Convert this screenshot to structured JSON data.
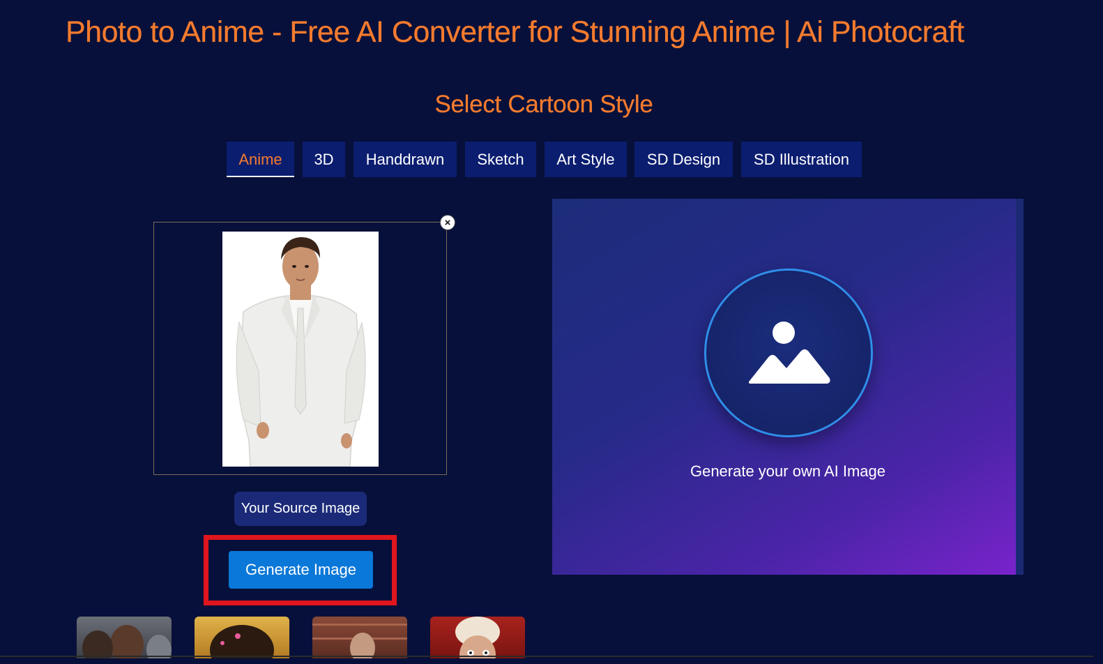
{
  "page": {
    "title": "Photo to Anime - Free AI Converter for Stunning Anime | Ai Photocraft",
    "section_title": "Select Cartoon Style"
  },
  "tabs": [
    {
      "label": "Anime",
      "active": true
    },
    {
      "label": "3D",
      "active": false
    },
    {
      "label": "Handdrawn",
      "active": false
    },
    {
      "label": "Sketch",
      "active": false
    },
    {
      "label": "Art Style",
      "active": false
    },
    {
      "label": "SD Design",
      "active": false
    },
    {
      "label": "SD Illustration",
      "active": false
    }
  ],
  "source": {
    "close_icon": "close-icon",
    "label": "Your Source Image"
  },
  "actions": {
    "generate_label": "Generate Image"
  },
  "preview": {
    "icon": "image-placeholder-icon",
    "text": "Generate your own AI Image"
  },
  "colors": {
    "background": "#07103a",
    "accent_orange": "#f57b2e",
    "tab_bg": "#0b1d6f",
    "button_blue": "#0a78d8",
    "highlight_red": "#e0161e"
  }
}
